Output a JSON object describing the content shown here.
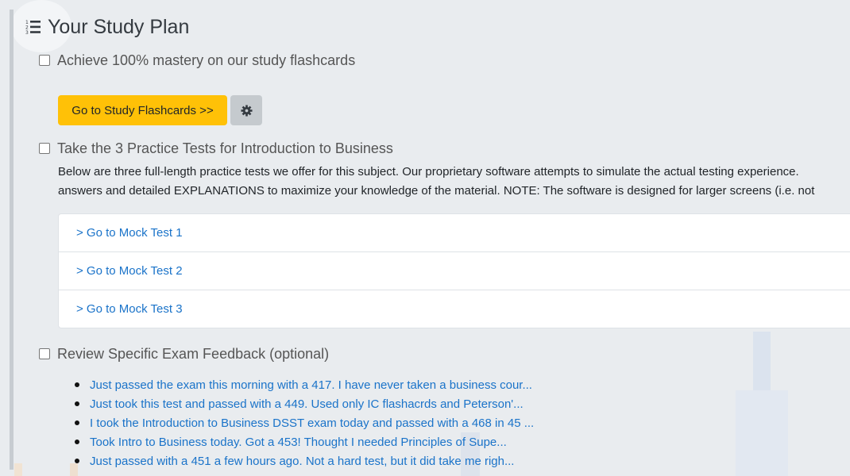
{
  "page": {
    "title": "Your Study Plan",
    "title_icon": "list-ol-icon"
  },
  "tasks": [
    {
      "label": "Achieve 100% mastery on our study flashcards",
      "checked": false
    },
    {
      "label": "Take the 3 Practice Tests for Introduction to Business",
      "checked": false
    },
    {
      "label": "Review Specific Exam Feedback (optional)",
      "checked": false
    }
  ],
  "flashcards": {
    "button_label": "Go to Study Flashcards >>",
    "settings_icon": "gear-icon"
  },
  "practice": {
    "description_line1": "Below are three full-length practice tests we offer for this subject. Our proprietary software attempts to simulate the actual testing experience.",
    "description_line2": "answers and detailed EXPLANATIONS to maximize your knowledge of the material. NOTE: The software is designed for larger screens (i.e. not",
    "mock_tests": [
      "> Go to Mock Test 1",
      "> Go to Mock Test 2",
      "> Go to Mock Test 3"
    ]
  },
  "feedback": [
    "Just passed the exam this morning with a 417. I have never taken a business cour...",
    "Just took this test and passed with a 449. Used only IC flashacrds and Peterson'...",
    "I took the Introduction to Business DSST exam today and passed with a 468 in 45 ...",
    "Took Intro to Business today.  Got a 453!  Thought I needed Principles of Supe...",
    "Just passed with a 451 a few hours ago. Not a hard test, but it did take me righ..."
  ],
  "colors": {
    "accent_button": "#ffc107",
    "link": "#1a73c9",
    "background": "#e9ecef"
  }
}
